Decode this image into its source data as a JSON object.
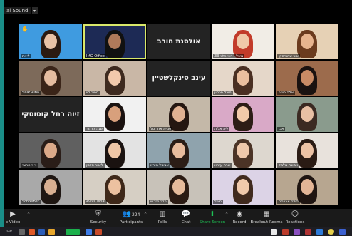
{
  "window": {
    "audio_label": "al Sound"
  },
  "tiles": [
    {
      "name": "ליאת",
      "bg": "#3f9be0",
      "skin": "#e9c2a6",
      "hair": "#2b1a12",
      "active": false,
      "icon": "hand"
    },
    {
      "name": "IMG Office",
      "bg": "#1d2a55",
      "skin": "#b07a5a",
      "hair": "#111",
      "active": true
    },
    {
      "big": "אולסנת חורב"
    },
    {
      "name": "מיכל - רוני הלוי 33",
      "bg": "#f1ede6",
      "skin": "#f0c8a8",
      "hair": "#c23b2a"
    },
    {
      "name": "אור שחורסקי",
      "bg": "#e6d1b5",
      "skin": "#e7b48e",
      "hair": "#6b3b1e"
    },
    {
      "name": "Saar Alba",
      "bg": "#7d6a5a",
      "skin": "#e5bca0",
      "hair": "#3a2418"
    },
    {
      "name": "ספיר לוי",
      "bg": "#c9b7a6",
      "skin": "#f2c9ac",
      "hair": "#3e2a1f"
    },
    {
      "big": "עינב סינקלשטיין"
    },
    {
      "name": "מיכל חכמון",
      "bg": "#e5d7c9",
      "skin": "#ebbf9f",
      "hair": "#4a2f22"
    },
    {
      "name": "אלה פייזר",
      "bg": "#9c6b4c",
      "skin": "#c98b65",
      "hair": "#1a1210"
    },
    {
      "big": "זיוה רחל קוסוסקי"
    },
    {
      "name": "שנה קרמר",
      "bg": "#f1f1f1",
      "skin": "#d8a07c",
      "hair": "#1a1210"
    },
    {
      "name": "עמית אחריטל",
      "bg": "#c4b8a8",
      "skin": "#e0b192",
      "hair": "#241611"
    },
    {
      "name": "ליה אליה",
      "bg": "#d9a9c7",
      "skin": "#f2caa9",
      "hair": "#2d1d16"
    },
    {
      "name": "אבי",
      "bg": "#8a9b8d",
      "skin": "#e8c0a4",
      "hair": "#3b2a22"
    },
    {
      "name": "ג׳ני הרובי",
      "bg": "#606060",
      "skin": "#dba989",
      "hair": "#2a1d18"
    },
    {
      "name": "ליאור סלמן",
      "bg": "#e3e3e3",
      "skin": "#efc6a6",
      "hair": "#1a1210"
    },
    {
      "name": "אביגיל מורנו",
      "bg": "#8fa3ad",
      "skin": "#e8bc9d",
      "hair": "#2b1d16"
    },
    {
      "name": "שרה עזרא",
      "bg": "#ddd7cf",
      "skin": "#efc8ab",
      "hair": "#4b3326"
    },
    {
      "name": "אמונה מלמד",
      "bg": "#e8e2dc",
      "skin": "#ecc2a4",
      "hair": "#2a1b14"
    },
    {
      "name": "Schreiber",
      "bg": "#a9a9a9",
      "skin": "#d9b092",
      "hair": "#1e1612"
    },
    {
      "name": "Aviva Ishai",
      "bg": "#d6cfc4",
      "skin": "#ecc1a0",
      "hair": "#3e2819"
    },
    {
      "name": "הדר מזרחי",
      "bg": "#c8c2b9",
      "skin": "#e6bb9b",
      "hair": "#2b1b13"
    },
    {
      "name": "מיכל",
      "bg": "#dcd3e6",
      "skin": "#f0c9ab",
      "hair": "#402a1e"
    },
    {
      "name": "הילה אברהם",
      "bg": "#b7a690",
      "skin": "#e3b596",
      "hair": "#1f1511"
    }
  ],
  "toolbar": {
    "video_label": "p Video",
    "security_label": "Security",
    "participants_label": "Participants",
    "participants_count": "224",
    "polls_label": "Polls",
    "chat_label": "Chat",
    "share_label": "Share Screen",
    "record_label": "Record",
    "breakout_label": "Breakout Rooms",
    "reactions_label": "Reactions"
  },
  "taskbar": {
    "lang": "עבר"
  }
}
